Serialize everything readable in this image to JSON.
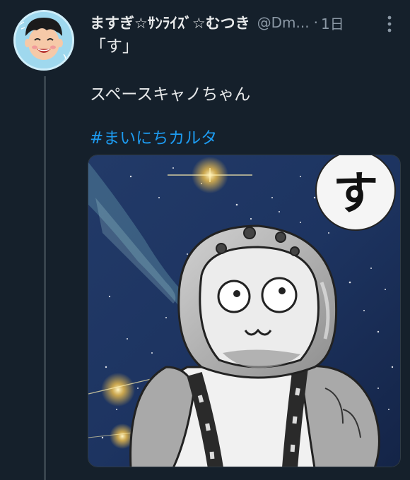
{
  "tweet": {
    "display_name": "ますぎ☆ｻﾝﾗｲｽﾞ☆むつき",
    "handle": "@Dm...",
    "separator": "·",
    "time": "1日",
    "text": "「す」\n\nスペースキャノちゃん",
    "hashtag": "#まいにちカルタ"
  },
  "media": {
    "karuta_letter": "す"
  },
  "icons": {
    "more": "more-vertical-icon",
    "avatar": "avatar-icon"
  },
  "colors": {
    "background": "#15202b",
    "text": "#e7e9ea",
    "secondary": "#8b98a5",
    "link": "#1d9bf0"
  }
}
